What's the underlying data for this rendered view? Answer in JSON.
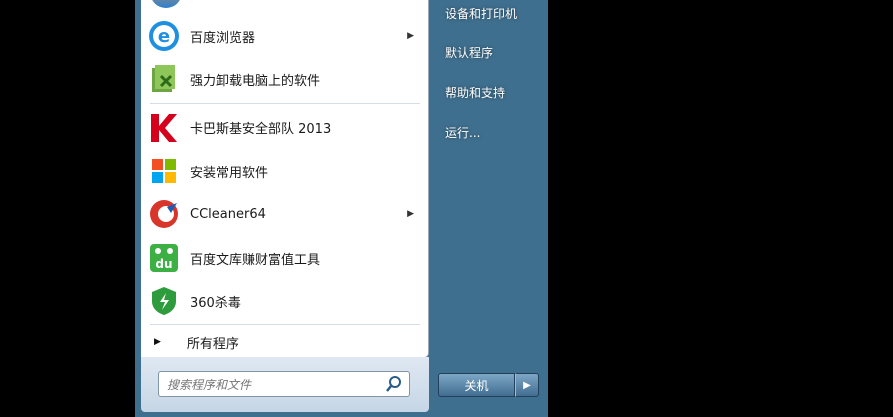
{
  "programs": [
    {
      "label": "百度浏览器",
      "icon": "baidu-browser-icon",
      "submenu": true
    },
    {
      "label": "强力卸载电脑上的软件",
      "icon": "uninstall-software-icon",
      "submenu": false
    },
    {
      "label": "卡巴斯基安全部队 2013",
      "icon": "kaspersky-icon",
      "submenu": false
    },
    {
      "label": "安装常用软件",
      "icon": "windows-install-icon",
      "submenu": false
    },
    {
      "label": "CCleaner64",
      "icon": "ccleaner-icon",
      "submenu": true
    },
    {
      "label": "百度文库赚财富值工具",
      "icon": "baidu-wenku-icon",
      "submenu": false
    },
    {
      "label": "360杀毒",
      "icon": "360-antivirus-icon",
      "submenu": false
    }
  ],
  "all_programs": "所有程序",
  "search": {
    "placeholder": "搜索程序和文件"
  },
  "right_pane": [
    "设备和打印机",
    "默认程序",
    "帮助和支持",
    "运行..."
  ],
  "shutdown": {
    "label": "关机"
  }
}
